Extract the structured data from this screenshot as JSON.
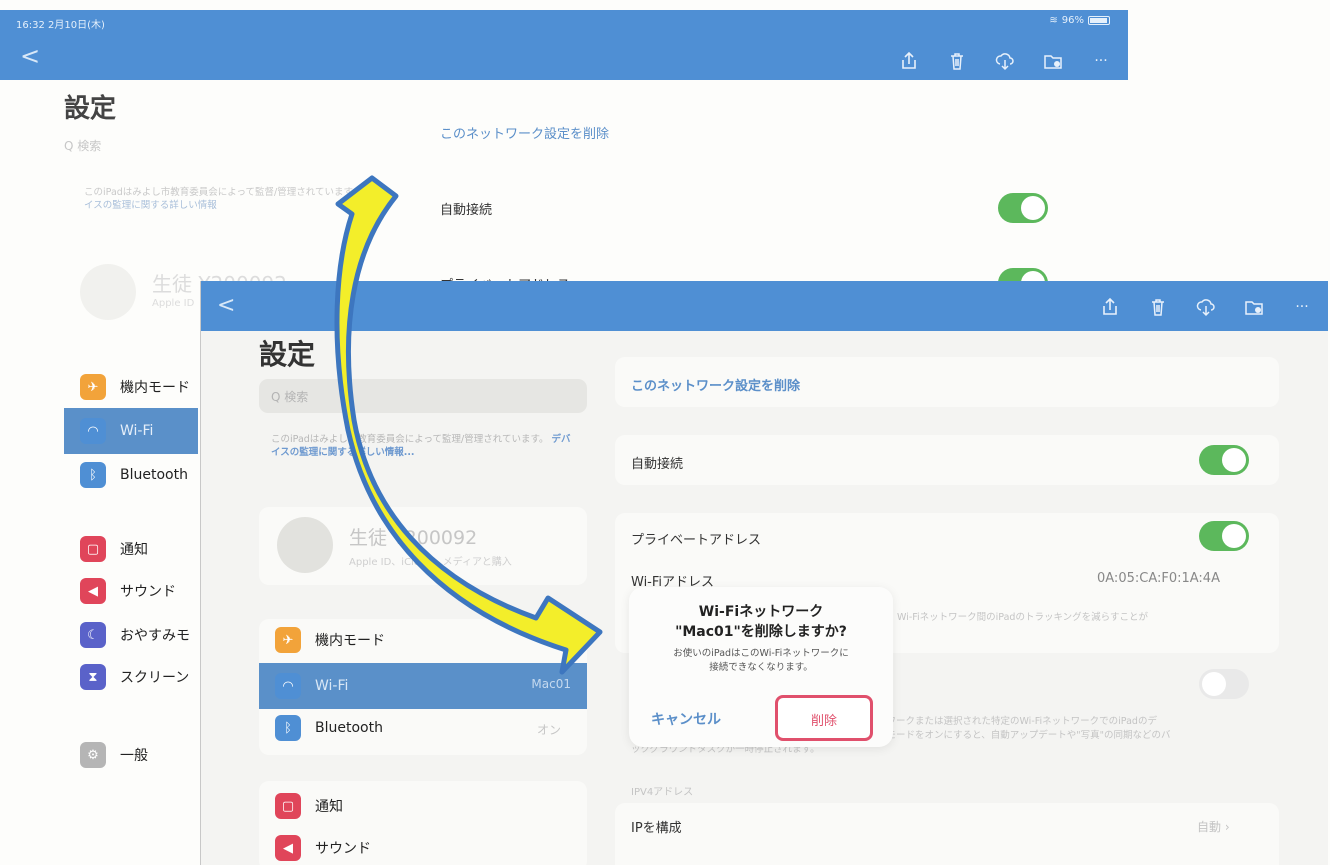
{
  "background_screen": {
    "status_time": "16:32  2月10日(木)",
    "battery": "96%",
    "back_glyph": "<",
    "title": "設定",
    "search_placeholder": "Q 検索",
    "supervise_text": "このiPadはみよし市教育委員会によって監督/管理されています。",
    "supervise_link": "デバイスの監理に関する詳しい情報",
    "profile_name": "生徒 Y200092",
    "profile_sub": "Apple ID",
    "forget_network": "このネットワーク設定を削除",
    "auto_join": "自動接続",
    "private_address": "プライベートアドレス",
    "menu": [
      {
        "label": "機内モード",
        "color": "#f2a33a",
        "icon": "airplane-icon"
      },
      {
        "label": "Wi-Fi",
        "color": "#4f8fd4",
        "icon": "wifi-icon"
      },
      {
        "label": "Bluetooth",
        "color": "#4f8fd4",
        "icon": "bluetooth-icon"
      },
      {
        "label": "通知",
        "color": "#e0455a",
        "icon": "notification-icon"
      },
      {
        "label": "サウンド",
        "color": "#e0455a",
        "icon": "sound-icon"
      },
      {
        "label": "おやすみモ",
        "color": "#5a62c9",
        "icon": "moon-icon"
      },
      {
        "label": "スクリーン",
        "color": "#5a62c9",
        "icon": "hourglass-icon"
      },
      {
        "label": "一般",
        "color": "#9a9a9a",
        "icon": "gear-icon"
      }
    ]
  },
  "front_screen": {
    "back_glyph": "<",
    "title": "設定",
    "search_placeholder": "Q 検索",
    "supervise_text": "このiPadはみよし市教育委員会によって監理/管理されています。",
    "supervise_link": "デバイスの監理に関する詳しい情報...",
    "profile_name": "生徒 Y200092",
    "profile_sub": "Apple ID、iCloud、メディアと購入",
    "menu": [
      {
        "label": "機内モード",
        "value": "",
        "color": "#f2a33a",
        "icon": "airplane-icon"
      },
      {
        "label": "Wi-Fi",
        "value": "Mac01",
        "color": "#4f8fd4",
        "icon": "wifi-icon"
      },
      {
        "label": "Bluetooth",
        "value": "オン",
        "color": "#4f8fd4",
        "icon": "bluetooth-icon"
      },
      {
        "label": "通知",
        "value": "",
        "color": "#e0455a",
        "icon": "notification-icon"
      },
      {
        "label": "サウンド",
        "value": "",
        "color": "#e0455a",
        "icon": "sound-icon"
      }
    ],
    "forget_network": "このネットワーク設定を削除",
    "auto_join": "自動接続",
    "private_address": "プライベートアドレス",
    "wifi_address_label": "Wi-Fiアドレス",
    "wifi_address_value": "0A:05:CA:F0:1A:4A",
    "private_note": "Wi-Fiネットワーク間のiPadのトラッキングを減らすことが",
    "low_data_note1": "トワークまたは選択された特定のWi-FiネットワークでのiPadのデ",
    "low_data_note2": "タモードをオンにすると、自動アップデートや\"写真\"の同期などのバ",
    "low_data_note3": "ックグラウンドタスクが一時停止されます。",
    "ipv4_header": "IPV4アドレス",
    "configure_ip": "IPを構成",
    "configure_ip_value": "自動"
  },
  "dialog": {
    "title_line1": "Wi-Fiネットワーク",
    "title_line2": "\"Mac01\"を削除しますか?",
    "message_line1": "お使いのiPadはこのWi-Fiネットワークに",
    "message_line2": "接続できなくなります。",
    "cancel": "キャンセル",
    "delete": "削除"
  }
}
